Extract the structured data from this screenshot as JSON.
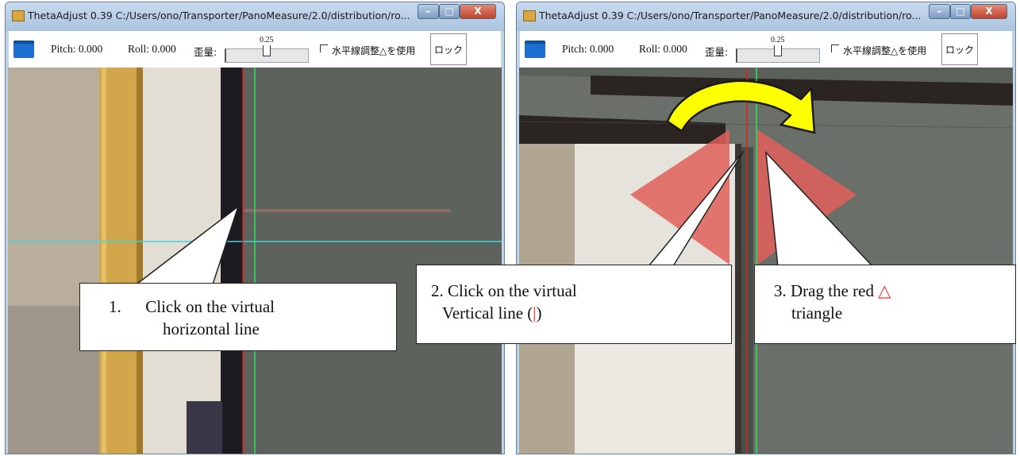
{
  "windows": [
    {
      "title": "ThetaAdjust 0.39  C:/Users/ono/Transporter/PanoMeasure/2.0/distribution/ro...",
      "pitch": "Pitch: 0.000",
      "roll": "Roll: 0.000",
      "distortion_label": "歪量:",
      "slider_value": "0.25",
      "checkbox_label": "水平線調整△を使用",
      "checkbox_checked": false,
      "lock_button": "ロック",
      "window_buttons": [
        "–",
        "□",
        "X"
      ]
    },
    {
      "title": "ThetaAdjust 0.39  C:/Users/ono/Transporter/PanoMeasure/2.0/distribution/ro...",
      "pitch": "Pitch: 0.000",
      "roll": "Roll: 0.000",
      "distortion_label": "歪量:",
      "slider_value": "0.25",
      "checkbox_label": "水平線調整△を使用",
      "checkbox_checked": false,
      "lock_button": "ロック",
      "window_buttons": [
        "–",
        "□",
        "X"
      ]
    }
  ],
  "callouts": {
    "step1_num": "1.",
    "step1_line1": "Click on the virtual",
    "step1_line2": "horizontal line",
    "step2_line1": "2. Click on the virtual",
    "step2_line2_pre": "Vertical line (",
    "step2_symbol": "|",
    "step2_line2_post": ")",
    "step3_line1_pre": "3. Drag the red ",
    "step3_symbol": "△",
    "step3_line2": "triangle"
  },
  "colors": {
    "horizontal_guide": "#3fd3e3",
    "vertical_guide_green": "#2ee05a",
    "vertical_guide_red": "#e0201c",
    "drag_triangle": "#e0605a",
    "arrow_fill": "#ffff00",
    "folder_icon": "#1a6fd0"
  }
}
